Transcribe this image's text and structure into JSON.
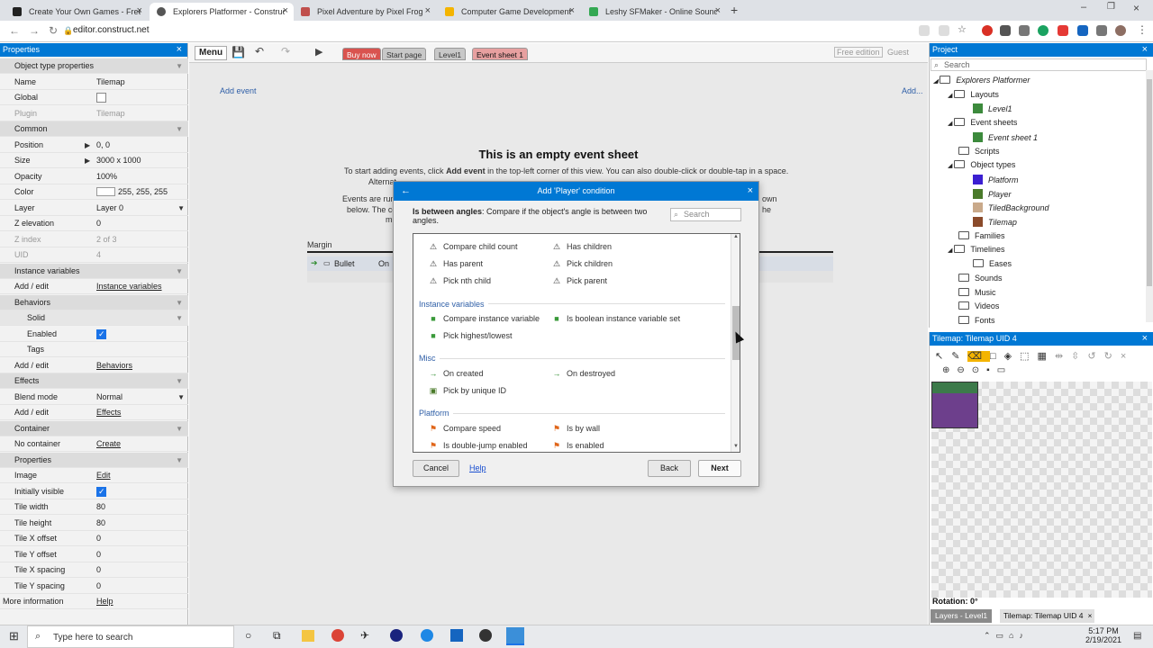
{
  "browser": {
    "tabs": [
      {
        "title": "Create Your Own Games - Free T",
        "color": "#222222"
      },
      {
        "title": "Explorers Platformer - Construct",
        "color": "#444444",
        "active": true
      },
      {
        "title": "Pixel Adventure by Pixel Frog",
        "color": "#c0504d"
      },
      {
        "title": "Computer Game Development W",
        "color": "#f4b400"
      },
      {
        "title": "Leshy SFMaker - Online Sound E",
        "color": "#34a853"
      }
    ],
    "url": "editor.construct.net"
  },
  "properties": {
    "title": "Properties",
    "rows": [
      {
        "name": "Object type properties",
        "type": "section"
      },
      {
        "name": "Name",
        "value": "Tilemap"
      },
      {
        "name": "Global",
        "check": false
      },
      {
        "name": "Plugin",
        "value": "Tilemap",
        "disabled": true
      },
      {
        "name": "Common",
        "type": "section"
      },
      {
        "name": "Position",
        "value": "0, 0",
        "arrow": true
      },
      {
        "name": "Size",
        "value": "3000 x 1000",
        "arrow": true
      },
      {
        "name": "Opacity",
        "value": "100%"
      },
      {
        "name": "Color",
        "value": "255, 255, 255",
        "swatch": true
      },
      {
        "name": "Layer",
        "value": "Layer 0",
        "select": true
      },
      {
        "name": "Z elevation",
        "value": "0"
      },
      {
        "name": "Z index",
        "value": "2 of 3",
        "disabled": true
      },
      {
        "name": "UID",
        "value": "4",
        "disabled": true
      },
      {
        "name": "Instance variables",
        "type": "section"
      },
      {
        "name": "Add / edit",
        "link": "Instance variables"
      },
      {
        "name": "Behaviors",
        "type": "section"
      },
      {
        "name": "Solid",
        "type": "subsection"
      },
      {
        "name": "Enabled",
        "check": true,
        "indent": true
      },
      {
        "name": "Tags",
        "indent": true
      },
      {
        "name": "Add / edit",
        "link": "Behaviors"
      },
      {
        "name": "Effects",
        "type": "section"
      },
      {
        "name": "Blend mode",
        "value": "Normal",
        "select": true
      },
      {
        "name": "Add / edit",
        "link": "Effects"
      },
      {
        "name": "Container",
        "type": "section"
      },
      {
        "name": "No container",
        "link": "Create"
      },
      {
        "name": "Properties",
        "type": "section"
      },
      {
        "name": "Image",
        "link": "Edit"
      },
      {
        "name": "Initially visible",
        "check": true
      },
      {
        "name": "Tile width",
        "value": "80"
      },
      {
        "name": "Tile height",
        "value": "80"
      },
      {
        "name": "Tile X offset",
        "value": "0"
      },
      {
        "name": "Tile Y offset",
        "value": "0"
      },
      {
        "name": "Tile X spacing",
        "value": "0"
      },
      {
        "name": "Tile Y spacing",
        "value": "0"
      },
      {
        "name": "More information",
        "link": "Help",
        "noindent": true
      }
    ]
  },
  "toolbar": {
    "menu": "Menu",
    "tabs": [
      "Buy now",
      "Start page",
      "Level1",
      "Event sheet 1"
    ],
    "edition": "Free edition",
    "user": "Guest"
  },
  "eventsheet": {
    "add_event": "Add event",
    "add_right": "Add...",
    "empty_title": "This is an empty event sheet",
    "line1a": "To start adding events, click ",
    "line1b": "Add event",
    "line1c": " in the top-left corner of this view. You can also double-click or double-tap in a space.",
    "line2": "Alternat",
    "line3a": "Events are run",
    "line3b": "own",
    "line4a": "below. The co",
    "line4b": "he",
    "line5": "m",
    "margin_label": "Margin",
    "row_label": "Bullet",
    "row_on": "On"
  },
  "dialog": {
    "title": "Add 'Player' condition",
    "desc_bold": "Is between angles",
    "desc_rest": ": Compare if the object's angle is between two angles.",
    "search_placeholder": "Search",
    "groups": {
      "instance": "Instance variables",
      "misc": "Misc",
      "platform": "Platform"
    },
    "items": {
      "compare_child_count": "Compare child count",
      "has_children": "Has children",
      "has_parent": "Has parent",
      "pick_children": "Pick children",
      "pick_nth_child": "Pick nth child",
      "pick_parent": "Pick parent",
      "compare_instance_variable": "Compare instance variable",
      "is_boolean_set": "Is boolean instance variable set",
      "pick_highest_lowest": "Pick highest/lowest",
      "on_created": "On created",
      "on_destroyed": "On destroyed",
      "pick_by_uid": "Pick by unique ID",
      "compare_speed": "Compare speed",
      "is_by_wall": "Is by wall",
      "is_double_jump": "Is double-jump enabled",
      "is_enabled": "Is enabled"
    },
    "buttons": {
      "cancel": "Cancel",
      "help": "Help",
      "back": "Back",
      "next": "Next"
    }
  },
  "project": {
    "title": "Project",
    "search": "Search",
    "tree": [
      {
        "label": "Explorers Platformer",
        "level": 0,
        "italic": true,
        "expand": true
      },
      {
        "label": "Layouts",
        "level": 1,
        "expand": true
      },
      {
        "label": "Level1",
        "level": 2,
        "italic": true,
        "swatch": "#3c8a3c"
      },
      {
        "label": "Event sheets",
        "level": 1,
        "expand": true
      },
      {
        "label": "Event sheet 1",
        "level": 2,
        "italic": true,
        "swatch": "#3c8a3c"
      },
      {
        "label": "Scripts",
        "level": 1
      },
      {
        "label": "Object types",
        "level": 1,
        "expand": true
      },
      {
        "label": "Platform",
        "level": 2,
        "italic": true,
        "swatch": "#3b1fd1"
      },
      {
        "label": "Player",
        "level": 2,
        "italic": true,
        "swatch": "#4a7a2a"
      },
      {
        "label": "TiledBackground",
        "level": 2,
        "italic": true,
        "swatch": "#c9a98a"
      },
      {
        "label": "Tilemap",
        "level": 2,
        "italic": true,
        "swatch": "#8a4a2a"
      },
      {
        "label": "Families",
        "level": 1
      },
      {
        "label": "Timelines",
        "level": 1,
        "expand": true
      },
      {
        "label": "Eases",
        "level": 2
      },
      {
        "label": "Sounds",
        "level": 1
      },
      {
        "label": "Music",
        "level": 1
      },
      {
        "label": "Videos",
        "level": 1
      },
      {
        "label": "Fonts",
        "level": 1
      }
    ]
  },
  "tilemap_panel": {
    "title": "Tilemap: Tilemap UID 4",
    "rotation": "Rotation: 0°",
    "bottom_tabs": [
      "Layers - Level1",
      "Tilemap: Tilemap UID 4"
    ]
  },
  "taskbar": {
    "search": "Type here to search",
    "time": "5:17 PM",
    "date": "2/19/2021"
  }
}
